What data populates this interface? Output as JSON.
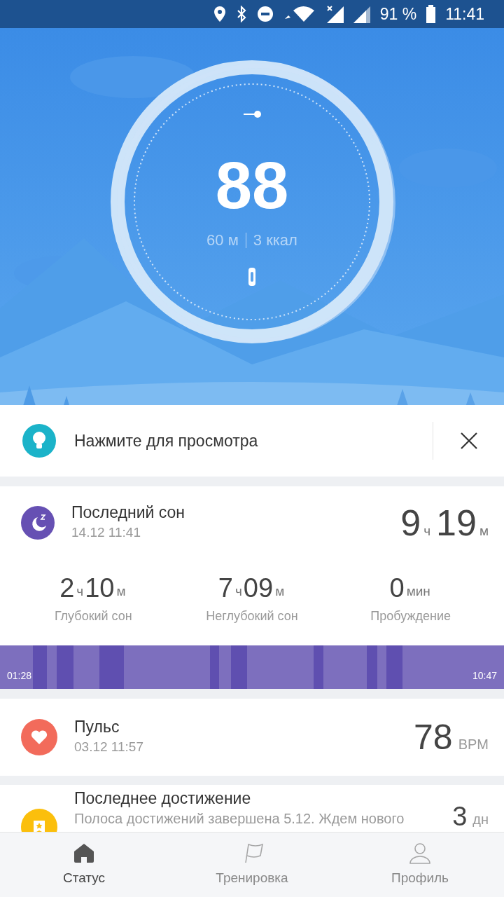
{
  "status_bar": {
    "battery": "91 %",
    "time": "11:41"
  },
  "activity": {
    "steps": "88",
    "distance": "60 м",
    "calories": "3 ккал"
  },
  "tip": {
    "text": "Нажмите для просмотра"
  },
  "sleep": {
    "title": "Последний сон",
    "date": "14.12 11:41",
    "hours": "9",
    "hours_unit": "ч",
    "minutes": "19",
    "minutes_unit": "м",
    "stats": [
      {
        "parts": [
          {
            "number": "2",
            "unit": "ч"
          },
          {
            "number": "10",
            "unit": "м"
          }
        ],
        "label": "Глубокий сон"
      },
      {
        "parts": [
          {
            "number": "7",
            "unit": "ч"
          },
          {
            "number": "09",
            "unit": "м"
          }
        ],
        "label": "Неглубокий сон"
      },
      {
        "parts": [
          {
            "number": "0",
            "unit": "мин"
          }
        ],
        "label": "Пробуждение"
      }
    ],
    "timeline": {
      "start": "01:28",
      "end": "10:47"
    }
  },
  "pulse": {
    "title": "Пульс",
    "date": "03.12 11:57",
    "value": "78",
    "unit": "BPM"
  },
  "achievement": {
    "title": "Последнее достижение",
    "description": "Полоса достижений завершена 5.12. Ждем нового",
    "value": "3",
    "unit": "дн"
  },
  "nav": [
    {
      "label": "Статус",
      "selected": true,
      "kind": "home"
    },
    {
      "label": "Тренировка",
      "selected": false,
      "kind": "flag"
    },
    {
      "label": "Профиль",
      "selected": false,
      "kind": "person"
    }
  ]
}
